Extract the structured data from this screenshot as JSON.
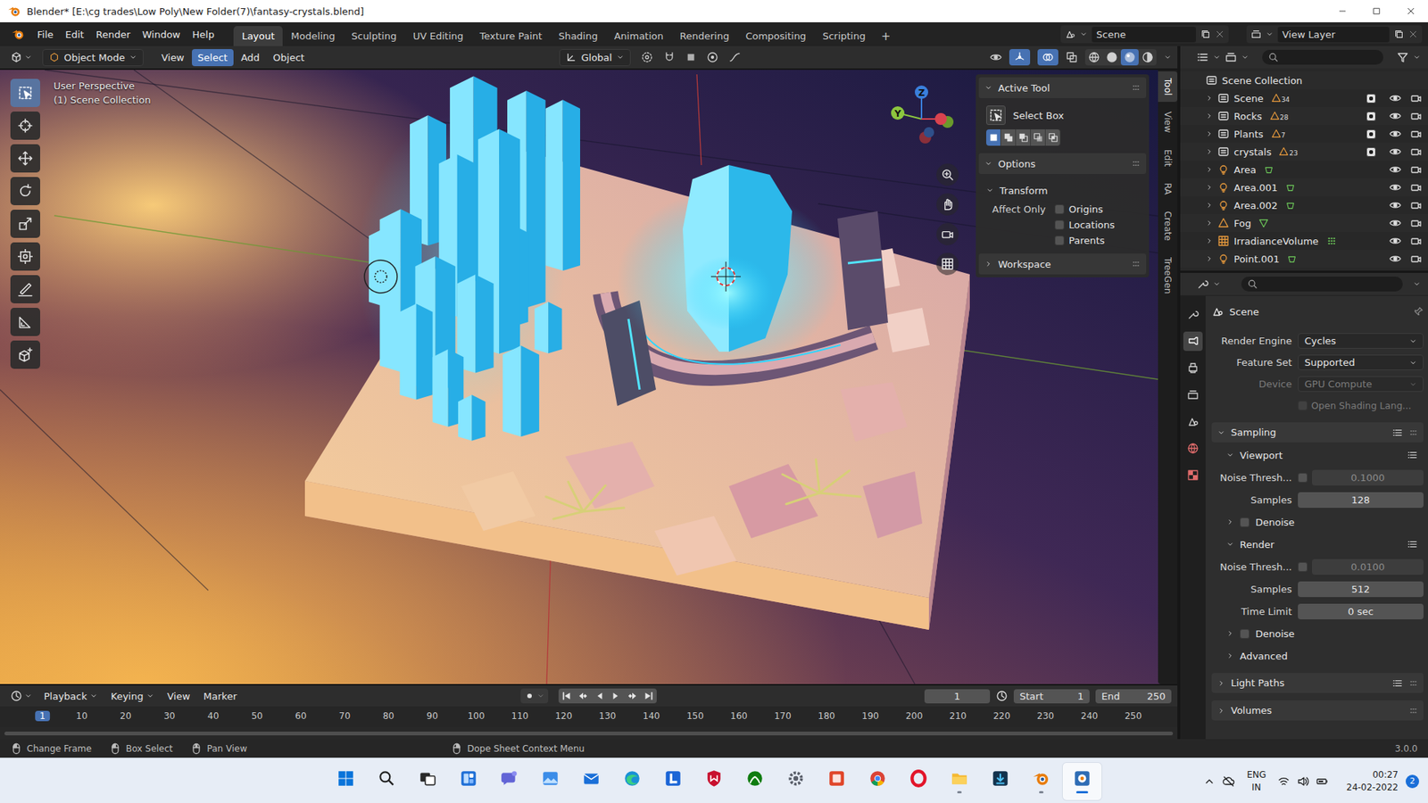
{
  "window": {
    "title": "Blender* [E:\\cg trades\\Low Poly\\New Folder(7)\\fantasy-crystals.blend]"
  },
  "topbar": {
    "menus": [
      "File",
      "Edit",
      "Render",
      "Window",
      "Help"
    ],
    "workspaces": [
      {
        "label": "Layout",
        "selected": true
      },
      {
        "label": "Modeling",
        "selected": false
      },
      {
        "label": "Sculpting",
        "selected": false
      },
      {
        "label": "UV Editing",
        "selected": false
      },
      {
        "label": "Texture Paint",
        "selected": false
      },
      {
        "label": "Shading",
        "selected": false
      },
      {
        "label": "Animation",
        "selected": false
      },
      {
        "label": "Rendering",
        "selected": false
      },
      {
        "label": "Compositing",
        "selected": false
      },
      {
        "label": "Scripting",
        "selected": false
      }
    ],
    "add_workspace": "+",
    "scene": "Scene",
    "view_layer": "View Layer"
  },
  "viewport_header": {
    "mode": "Object Mode",
    "menus": [
      {
        "label": "View",
        "selected": false
      },
      {
        "label": "Select",
        "selected": true
      },
      {
        "label": "Add",
        "selected": false
      },
      {
        "label": "Object",
        "selected": false
      }
    ],
    "orientation": "Global",
    "shading": [
      {
        "mode": "wireframe",
        "selected": false
      },
      {
        "mode": "solid",
        "selected": false
      },
      {
        "mode": "material",
        "selected": true
      },
      {
        "mode": "rendered",
        "selected": false
      }
    ]
  },
  "viewport": {
    "overlay_text": [
      "User Perspective",
      "(1) Scene Collection"
    ],
    "gizmo_axes": [
      {
        "label": "Y",
        "color": "#8cc63f"
      },
      {
        "label": "Z",
        "color": "#3a7fdc"
      }
    ]
  },
  "toolbar": [
    {
      "kind": "select-box",
      "selected": true
    },
    {
      "kind": "cursor",
      "selected": false
    },
    {
      "kind": "move",
      "selected": false
    },
    {
      "kind": "rotate",
      "selected": false
    },
    {
      "kind": "scale",
      "selected": false
    },
    {
      "kind": "transform",
      "selected": false
    },
    {
      "kind": "annotate",
      "selected": false
    },
    {
      "kind": "measure",
      "selected": false
    },
    {
      "kind": "add-cube",
      "selected": false
    }
  ],
  "sidebar_tabs": [
    {
      "label": "Tool",
      "selected": true
    },
    {
      "label": "View",
      "selected": false
    },
    {
      "label": "Edit",
      "selected": false
    },
    {
      "label": "RA",
      "selected": false
    },
    {
      "label": "Create",
      "selected": false
    },
    {
      "label": "TreeGen",
      "selected": false
    }
  ],
  "sidebar": {
    "active_tool": {
      "title": "Active Tool",
      "expanded": true,
      "tool": "Select Box",
      "modes": [
        {
          "selected": true
        },
        {
          "selected": false
        },
        {
          "selected": false
        },
        {
          "selected": false
        },
        {
          "selected": false
        }
      ]
    },
    "options": {
      "title": "Options",
      "expanded": true,
      "transform": {
        "title": "Transform",
        "expanded": true,
        "label": "Affect Only",
        "checks": [
          {
            "label": "Origins",
            "checked": false
          },
          {
            "label": "Locations",
            "checked": false
          },
          {
            "label": "Parents",
            "checked": false
          }
        ]
      }
    },
    "workspace": {
      "title": "Workspace",
      "expanded": false
    }
  },
  "outliner": {
    "root": "Scene Collection",
    "collections": [
      {
        "name": "Scene",
        "count": "34",
        "checked": true,
        "visible": true,
        "renderable": true
      },
      {
        "name": "Rocks",
        "count": "28",
        "checked": true,
        "visible": true,
        "renderable": true
      },
      {
        "name": "Plants",
        "count": "7",
        "checked": true,
        "visible": true,
        "renderable": true
      },
      {
        "name": "crystals",
        "count": "23",
        "checked": true,
        "visible": true,
        "renderable": true
      }
    ],
    "objects": [
      {
        "name": "Area",
        "kind": "light",
        "visible": true,
        "renderable": true
      },
      {
        "name": "Area.001",
        "kind": "light",
        "visible": true,
        "renderable": true
      },
      {
        "name": "Area.002",
        "kind": "light",
        "visible": true,
        "renderable": true
      },
      {
        "name": "Fog",
        "kind": "mesh",
        "visible": true,
        "renderable": true
      },
      {
        "name": "IrradianceVolume",
        "kind": "probe",
        "visible": true,
        "renderable": true
      },
      {
        "name": "Point.001",
        "kind": "light",
        "visible": true,
        "renderable": true
      }
    ]
  },
  "properties": {
    "tabs": [
      {
        "kind": "tool",
        "selected": false
      },
      {
        "kind": "render",
        "selected": true
      },
      {
        "kind": "output",
        "selected": false
      },
      {
        "kind": "view-layer",
        "selected": false
      },
      {
        "kind": "scene",
        "selected": false
      },
      {
        "kind": "world",
        "selected": false
      },
      {
        "kind": "texture",
        "selected": false
      }
    ],
    "context": "Scene",
    "rows": [
      {
        "kind": "dropdown",
        "label": "Render Engine",
        "value": "Cycles",
        "disabled": false
      },
      {
        "kind": "dropdown",
        "label": "Feature Set",
        "value": "Supported",
        "disabled": false
      },
      {
        "kind": "dropdown",
        "label": "Device",
        "value": "GPU Compute",
        "disabled": true
      },
      {
        "kind": "check",
        "label": "Open Shading Lang...",
        "checked": false,
        "disabled": true
      },
      {
        "kind": "panel",
        "label": "Sampling",
        "expanded": true,
        "presets": true
      },
      {
        "kind": "subpanel",
        "label": "Viewport",
        "expanded": true,
        "presets": true
      },
      {
        "kind": "number-check",
        "label": "Noise Thresh...",
        "checked": false,
        "value": "0.1000",
        "disabled": true
      },
      {
        "kind": "number",
        "label": "Samples",
        "value": "128",
        "disabled": false
      },
      {
        "kind": "subpanel-check",
        "label": "Denoise",
        "expanded": false,
        "checked": false
      },
      {
        "kind": "subpanel",
        "label": "Render",
        "expanded": true,
        "presets": true
      },
      {
        "kind": "number-check",
        "label": "Noise Thresh...",
        "checked": false,
        "value": "0.0100",
        "disabled": true
      },
      {
        "kind": "number",
        "label": "Samples",
        "value": "512",
        "disabled": false
      },
      {
        "kind": "number",
        "label": "Time Limit",
        "value": "0 sec",
        "disabled": false
      },
      {
        "kind": "subpanel-check",
        "label": "Denoise",
        "expanded": false,
        "checked": false
      },
      {
        "kind": "subpanel",
        "label": "Advanced",
        "expanded": false,
        "presets": false
      },
      {
        "kind": "panel",
        "label": "Light Paths",
        "expanded": false,
        "presets": true
      },
      {
        "kind": "panel",
        "label": "Volumes",
        "expanded": false,
        "presets": false
      }
    ]
  },
  "timeline": {
    "menus": [
      {
        "label": "Playback",
        "dropdown": true
      },
      {
        "label": "Keying",
        "dropdown": true
      },
      {
        "label": "View",
        "dropdown": false
      },
      {
        "label": "Marker",
        "dropdown": false
      }
    ],
    "controls": [
      "jump-start",
      "key-prev",
      "play-reverse",
      "play",
      "key-next",
      "jump-end"
    ],
    "current_frame": "1",
    "start_label": "Start",
    "start": "1",
    "end_label": "End",
    "end": "250",
    "ruler": [
      {
        "label": "1",
        "selected": true
      },
      {
        "label": "10",
        "selected": false
      },
      {
        "label": "20",
        "selected": false
      },
      {
        "label": "30",
        "selected": false
      },
      {
        "label": "40",
        "selected": false
      },
      {
        "label": "50",
        "selected": false
      },
      {
        "label": "60",
        "selected": false
      },
      {
        "label": "70",
        "selected": false
      },
      {
        "label": "80",
        "selected": false
      },
      {
        "label": "90",
        "selected": false
      },
      {
        "label": "100",
        "selected": false
      },
      {
        "label": "110",
        "selected": false
      },
      {
        "label": "120",
        "selected": false
      },
      {
        "label": "130",
        "selected": false
      },
      {
        "label": "140",
        "selected": false
      },
      {
        "label": "150",
        "selected": false
      },
      {
        "label": "160",
        "selected": false
      },
      {
        "label": "170",
        "selected": false
      },
      {
        "label": "180",
        "selected": false
      },
      {
        "label": "190",
        "selected": false
      },
      {
        "label": "200",
        "selected": false
      },
      {
        "label": "210",
        "selected": false
      },
      {
        "label": "220",
        "selected": false
      },
      {
        "label": "230",
        "selected": false
      },
      {
        "label": "240",
        "selected": false
      },
      {
        "label": "250",
        "selected": false
      }
    ]
  },
  "status_bar": {
    "hints": [
      {
        "kind": "mouse-left",
        "label": "Change Frame"
      },
      {
        "kind": "mouse-left",
        "label": "Box Select"
      },
      {
        "kind": "mouse-middle",
        "label": "Pan View"
      },
      {
        "kind": "mouse-right",
        "label": "Dope Sheet Context Menu"
      }
    ],
    "version": "3.0.0"
  },
  "taskbar": {
    "apps": [
      {
        "kind": "start",
        "running": false,
        "active": false
      },
      {
        "kind": "search",
        "running": false,
        "active": false
      },
      {
        "kind": "taskview",
        "running": false,
        "active": false
      },
      {
        "kind": "widgets",
        "running": false,
        "active": false
      },
      {
        "kind": "chat",
        "running": false,
        "active": false
      },
      {
        "kind": "photos",
        "running": false,
        "active": false
      },
      {
        "kind": "mail",
        "running": false,
        "active": false
      },
      {
        "kind": "edge",
        "running": false,
        "active": false
      },
      {
        "kind": "lapp",
        "running": false,
        "active": false
      },
      {
        "kind": "mcafee",
        "running": false,
        "active": false
      },
      {
        "kind": "xbox",
        "running": false,
        "active": false
      },
      {
        "kind": "settings",
        "running": false,
        "active": false
      },
      {
        "kind": "office",
        "running": false,
        "active": false
      },
      {
        "kind": "chrome",
        "running": false,
        "active": false
      },
      {
        "kind": "opera",
        "running": false,
        "active": false
      },
      {
        "kind": "folder",
        "running": true,
        "active": false
      },
      {
        "kind": "download",
        "running": false,
        "active": false
      },
      {
        "kind": "blender",
        "running": true,
        "active": false
      },
      {
        "kind": "app",
        "running": true,
        "active": true
      }
    ],
    "tray": {
      "language": "ENG",
      "region": "IN",
      "time": "00:27",
      "date": "24-02-2022",
      "notifications": "2"
    }
  }
}
